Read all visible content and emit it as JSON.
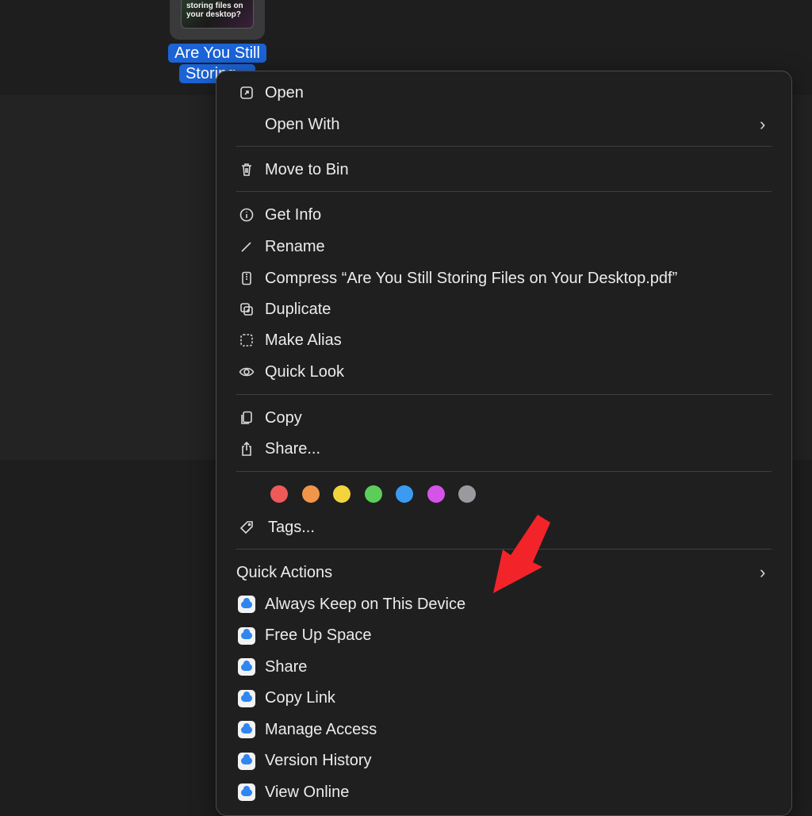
{
  "desktop_file": {
    "preview_lines": [
      "storing files on",
      "your desktop?"
    ],
    "label_line1": "Are You Still",
    "label_line2": "Storing..."
  },
  "menu": {
    "open": "Open",
    "open_with": "Open With",
    "move_to_bin": "Move to Bin",
    "get_info": "Get Info",
    "rename": "Rename",
    "compress": "Compress “Are You Still Storing Files on Your Desktop.pdf”",
    "duplicate": "Duplicate",
    "make_alias": "Make Alias",
    "quick_look": "Quick Look",
    "copy": "Copy",
    "share": "Share...",
    "tags": "Tags...",
    "quick_actions": "Quick Actions",
    "quick_action_items": [
      "Always Keep on This Device",
      "Free Up Space",
      "Share",
      "Copy Link",
      "Manage Access",
      "Version History",
      "View Online"
    ]
  },
  "tag_colors": [
    "#ee5a5a",
    "#f0964a",
    "#f3d43c",
    "#5ccd5a",
    "#3b9bf2",
    "#d653e9",
    "#9a9a9e"
  ],
  "annotation_arrow_color": "#f2242a"
}
